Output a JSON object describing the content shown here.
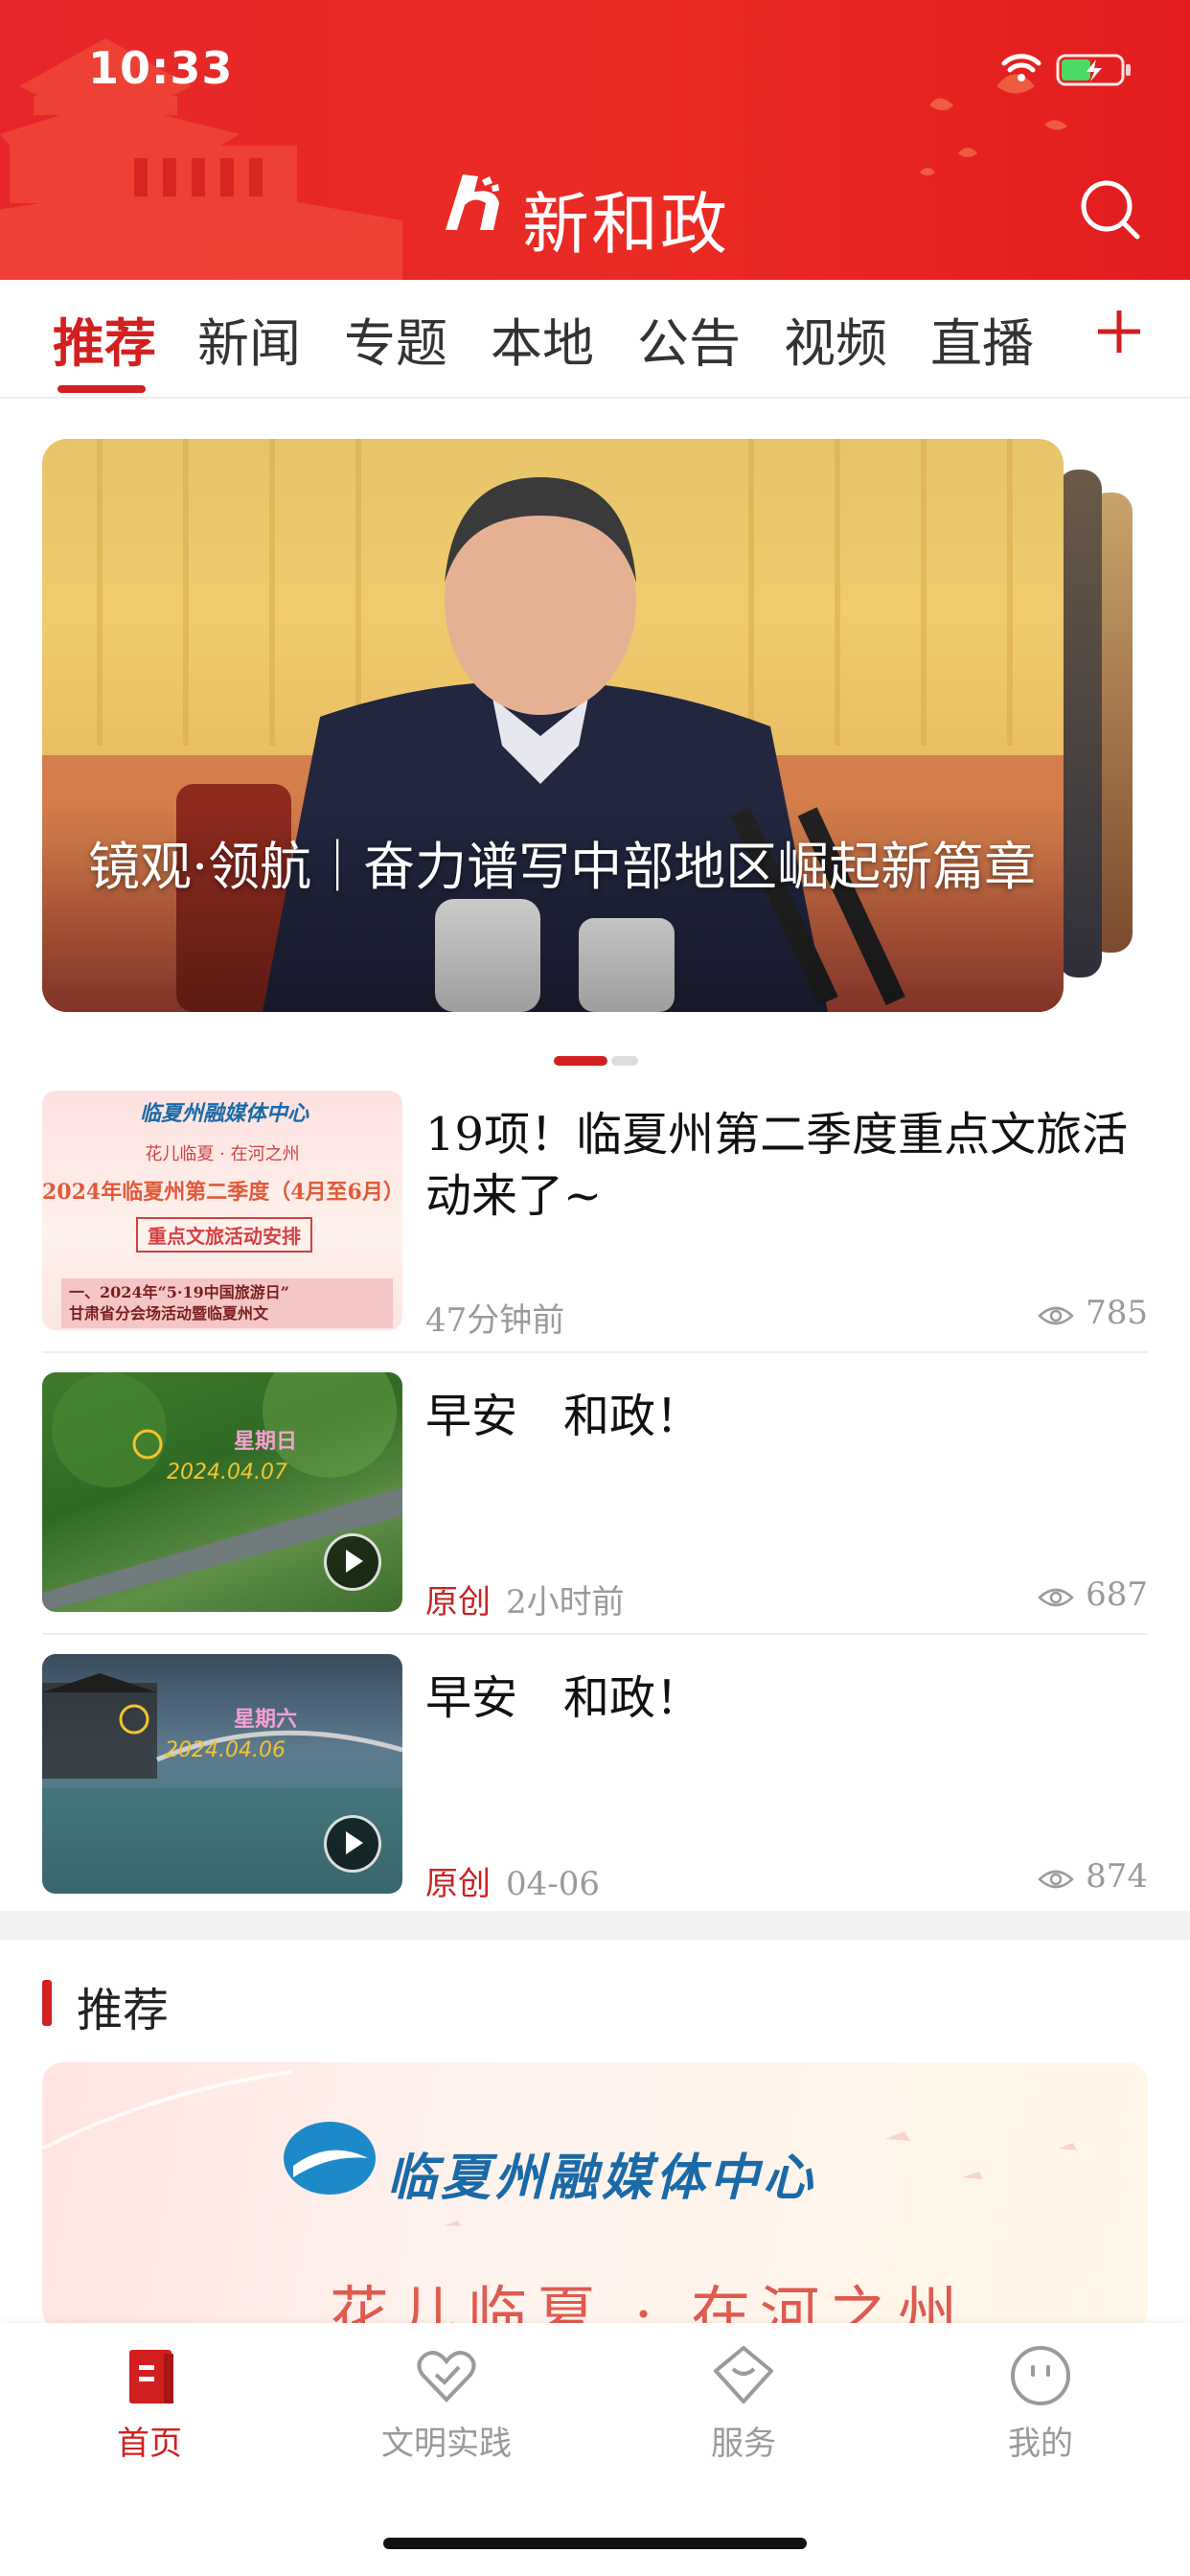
{
  "status": {
    "time": "10:33"
  },
  "header": {
    "app_name": "新和政",
    "search_icon": "search-icon"
  },
  "tabs": [
    {
      "label": "推荐",
      "active": true
    },
    {
      "label": "新闻"
    },
    {
      "label": "专题"
    },
    {
      "label": "本地"
    },
    {
      "label": "公告"
    },
    {
      "label": "视频"
    },
    {
      "label": "直播"
    }
  ],
  "tab_add_icon": "plus-icon",
  "carousel": {
    "title": "镜观·领航｜奋力谱写中部地区崛起新篇章",
    "current_index": 1,
    "total": 2
  },
  "news": [
    {
      "title": "19项！临夏州第二季度重点文旅活动来了~",
      "source": "",
      "time": "47分钟前",
      "views": "785",
      "thumb": {
        "brand": "临夏州融媒体中心",
        "line1": "花儿临夏 · 在河之州",
        "line2": "2024年临夏州第二季度（4月至6月）",
        "line3": "重点文旅活动安排",
        "line4": "一、2024年“5·19中国旅游日”",
        "line5": "甘肃省分会场活动暨临夏州文"
      }
    },
    {
      "title": "早安　和政！",
      "source": "原创",
      "time": "2小时前",
      "views": "687",
      "thumb": {
        "weekday": "星期日",
        "date": "2024.04.07"
      }
    },
    {
      "title": "早安　和政！",
      "source": "原创",
      "time": "04-06",
      "views": "874",
      "thumb": {
        "weekday": "星期六",
        "date": "2024.04.06"
      }
    }
  ],
  "recommend": {
    "section_title": "推荐",
    "banner_brand": "临夏州融媒体中心",
    "banner_sub": "花儿临夏 · 在河之州"
  },
  "bottom_nav": [
    {
      "label": "首页",
      "icon": "home-icon",
      "active": true
    },
    {
      "label": "文明实践",
      "icon": "heart-icon"
    },
    {
      "label": "服务",
      "icon": "service-icon"
    },
    {
      "label": "我的",
      "icon": "profile-icon"
    }
  ],
  "colors": {
    "brand_red": "#d21f1f",
    "header_red": "#e6262a"
  }
}
